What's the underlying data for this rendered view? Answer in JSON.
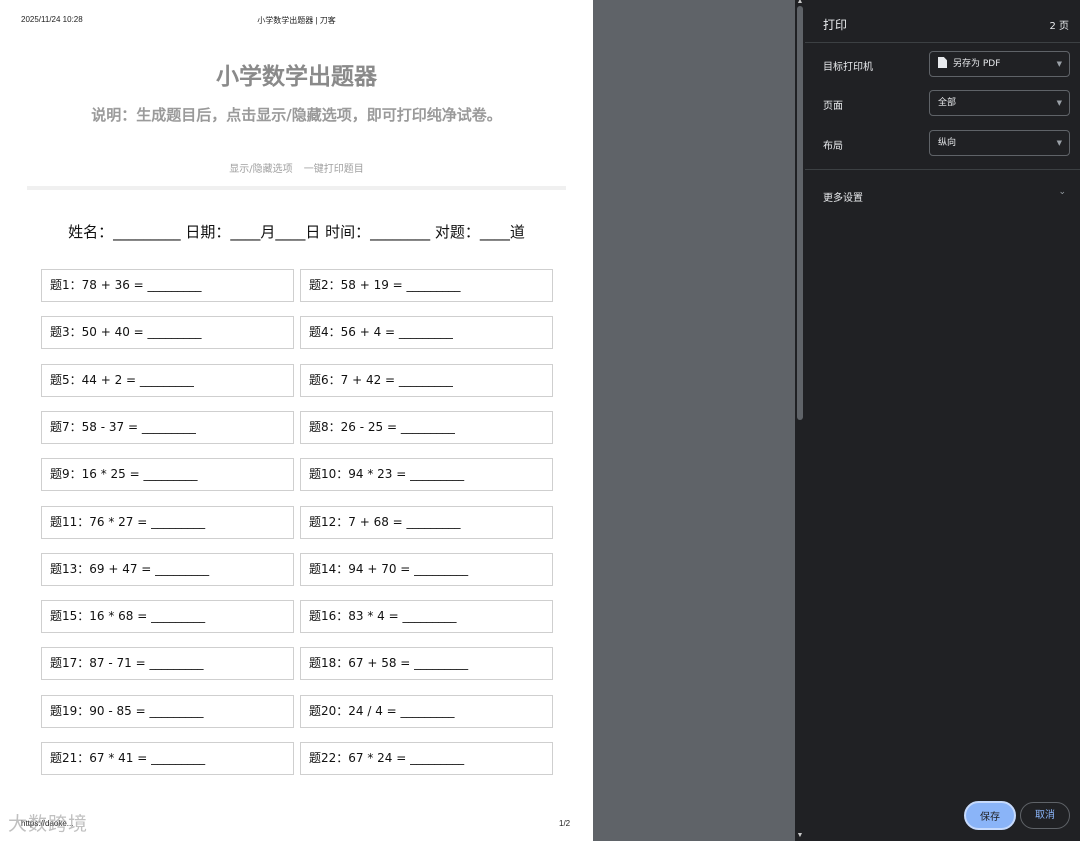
{
  "paper_header": {
    "date": "2025/11/24 10:28",
    "title": "小学数学出题器 | 刀客"
  },
  "paper_footer": {
    "url": "https://daoke...",
    "page": "1/2"
  },
  "app": {
    "title": "小学数学出题器",
    "description": "说明：生成题目后，点击显示/隐藏选项，即可打印纯净试卷。",
    "toggle_link": "显示/隐藏选项",
    "print_link": "一键打印题目"
  },
  "name_line": "姓名：_________ 日期：____月____日 时间：________ 对题：____道",
  "questions": [
    "题1：78 + 36 = _________",
    "题2：58 + 19 = _________",
    "题3：50 + 40 = _________",
    "题4：56 + 4 = _________",
    "题5：44 + 2 = _________",
    "题6：7 + 42 = _________",
    "题7：58 - 37 = _________",
    "题8：26 - 25 = _________",
    "题9：16 * 25 = _________",
    "题10：94 * 23 = _________",
    "题11：76 * 27 = _________",
    "题12：7 + 68 = _________",
    "题13：69 + 47 = _________",
    "题14：94 + 70 = _________",
    "题15：16 * 68 = _________",
    "题16：83 * 4 = _________",
    "题17：87 - 71 = _________",
    "题18：67 + 58 = _________",
    "题19：90 - 85 = _________",
    "题20：24 / 4 = _________",
    "题21：67 * 41 = _________",
    "题22：67 * 24 = _________"
  ],
  "print_panel": {
    "title": "打印",
    "page_count": "2 页",
    "destination_label": "目标打印机",
    "destination_value": "另存为 PDF",
    "pages_label": "页面",
    "pages_value": "全部",
    "layout_label": "布局",
    "layout_value": "纵向",
    "more_settings": "更多设置",
    "save_button": "保存",
    "cancel_button": "取消"
  },
  "watermark": "大数跨境",
  "icons": {
    "destination": "file-icon",
    "dropdown": "caret-down-icon",
    "expand": "chevron-down-icon"
  },
  "colors": {
    "panel_bg": "#202124",
    "accent": "#8ab4f8",
    "preview_bg": "#5f6368"
  }
}
